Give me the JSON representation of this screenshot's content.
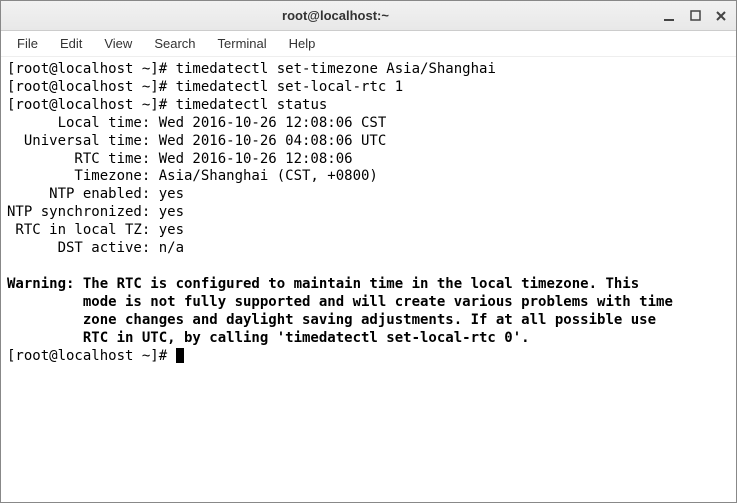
{
  "window": {
    "title": "root@localhost:~"
  },
  "menubar": {
    "items": [
      "File",
      "Edit",
      "View",
      "Search",
      "Terminal",
      "Help"
    ]
  },
  "terminal": {
    "prompt": "[root@localhost ~]# ",
    "lines": {
      "cmd1": "timedatectl set-timezone Asia/Shanghai",
      "cmd2": "timedatectl set-local-rtc 1",
      "cmd3": "timedatectl status",
      "status": "      Local time: Wed 2016-10-26 12:08:06 CST\n  Universal time: Wed 2016-10-26 04:08:06 UTC\n        RTC time: Wed 2016-10-26 12:08:06\n        Timezone: Asia/Shanghai (CST, +0800)\n     NTP enabled: yes\nNTP synchronized: yes\n RTC in local TZ: yes\n      DST active: n/a",
      "warning_label": "Warning: ",
      "warning_body": "The RTC is configured to maintain time in the local timezone. This\n         mode is not fully supported and will create various problems with time\n         zone changes and daylight saving adjustments. If at all possible use\n         RTC in UTC, by calling 'timedatectl set-local-rtc 0'."
    }
  }
}
